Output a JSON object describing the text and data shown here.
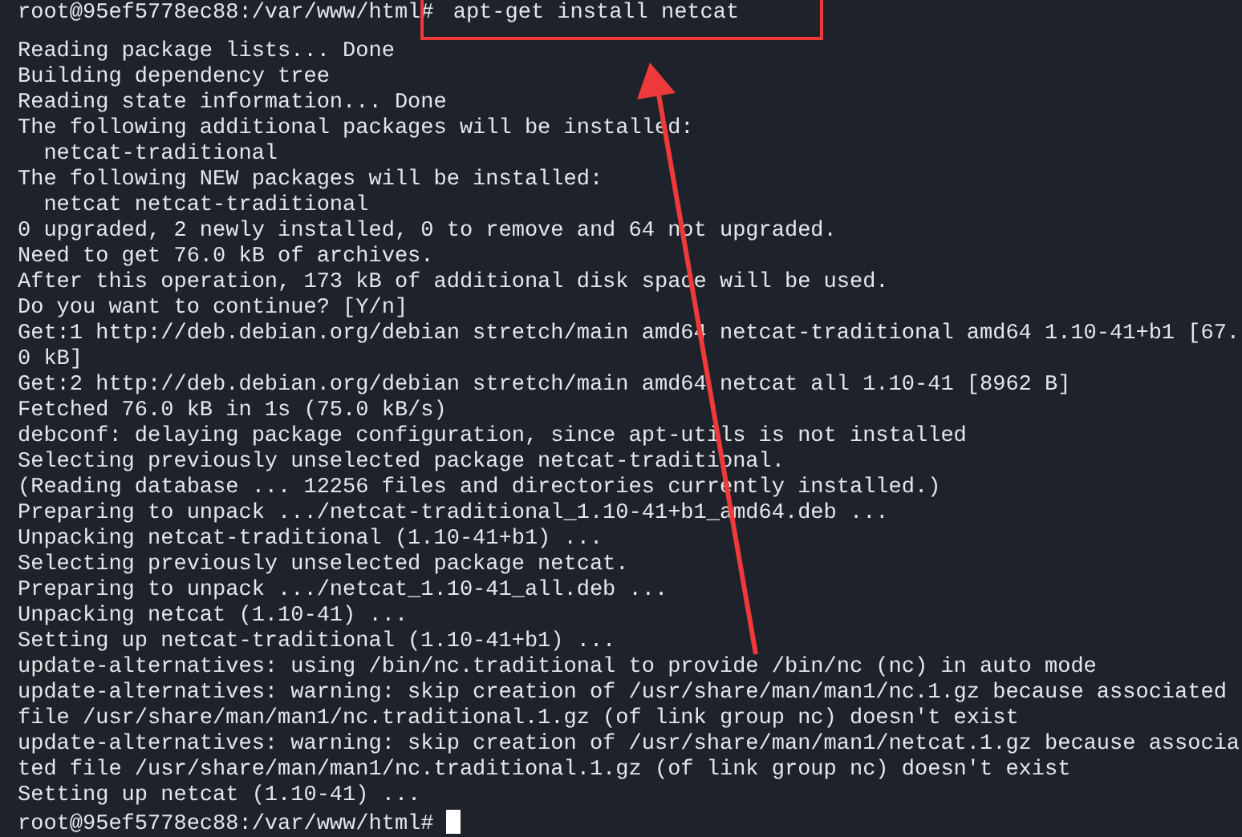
{
  "terminal": {
    "command_line": {
      "prompt": "root@95ef5778ec88:/var/www/html#",
      "command": "apt-get install netcat",
      "highlighted": true
    },
    "output_lines": [
      "Reading package lists... Done",
      "Building dependency tree",
      "Reading state information... Done",
      "The following additional packages will be installed:",
      "  netcat-traditional",
      "The following NEW packages will be installed:",
      "  netcat netcat-traditional",
      "0 upgraded, 2 newly installed, 0 to remove and 64 not upgraded.",
      "Need to get 76.0 kB of archives.",
      "After this operation, 173 kB of additional disk space will be used.",
      "Do you want to continue? [Y/n]",
      "Get:1 http://deb.debian.org/debian stretch/main amd64 netcat-traditional amd64 1.10-41+b1 [67.",
      "0 kB]",
      "Get:2 http://deb.debian.org/debian stretch/main amd64 netcat all 1.10-41 [8962 B]",
      "Fetched 76.0 kB in 1s (75.0 kB/s)",
      "debconf: delaying package configuration, since apt-utils is not installed",
      "Selecting previously unselected package netcat-traditional.",
      "(Reading database ... 12256 files and directories currently installed.)",
      "Preparing to unpack .../netcat-traditional_1.10-41+b1_amd64.deb ...",
      "Unpacking netcat-traditional (1.10-41+b1) ...",
      "Selecting previously unselected package netcat.",
      "Preparing to unpack .../netcat_1.10-41_all.deb ...",
      "Unpacking netcat (1.10-41) ...",
      "Setting up netcat-traditional (1.10-41+b1) ...",
      "update-alternatives: using /bin/nc.traditional to provide /bin/nc (nc) in auto mode",
      "update-alternatives: warning: skip creation of /usr/share/man/man1/nc.1.gz because associated",
      "file /usr/share/man/man1/nc.traditional.1.gz (of link group nc) doesn't exist",
      "update-alternatives: warning: skip creation of /usr/share/man/man1/netcat.1.gz because associa",
      "ted file /usr/share/man/man1/nc.traditional.1.gz (of link group nc) doesn't exist",
      "Setting up netcat (1.10-41) ..."
    ],
    "final_prompt": "root@95ef5778ec88:/var/www/html#",
    "cursor": true
  }
}
